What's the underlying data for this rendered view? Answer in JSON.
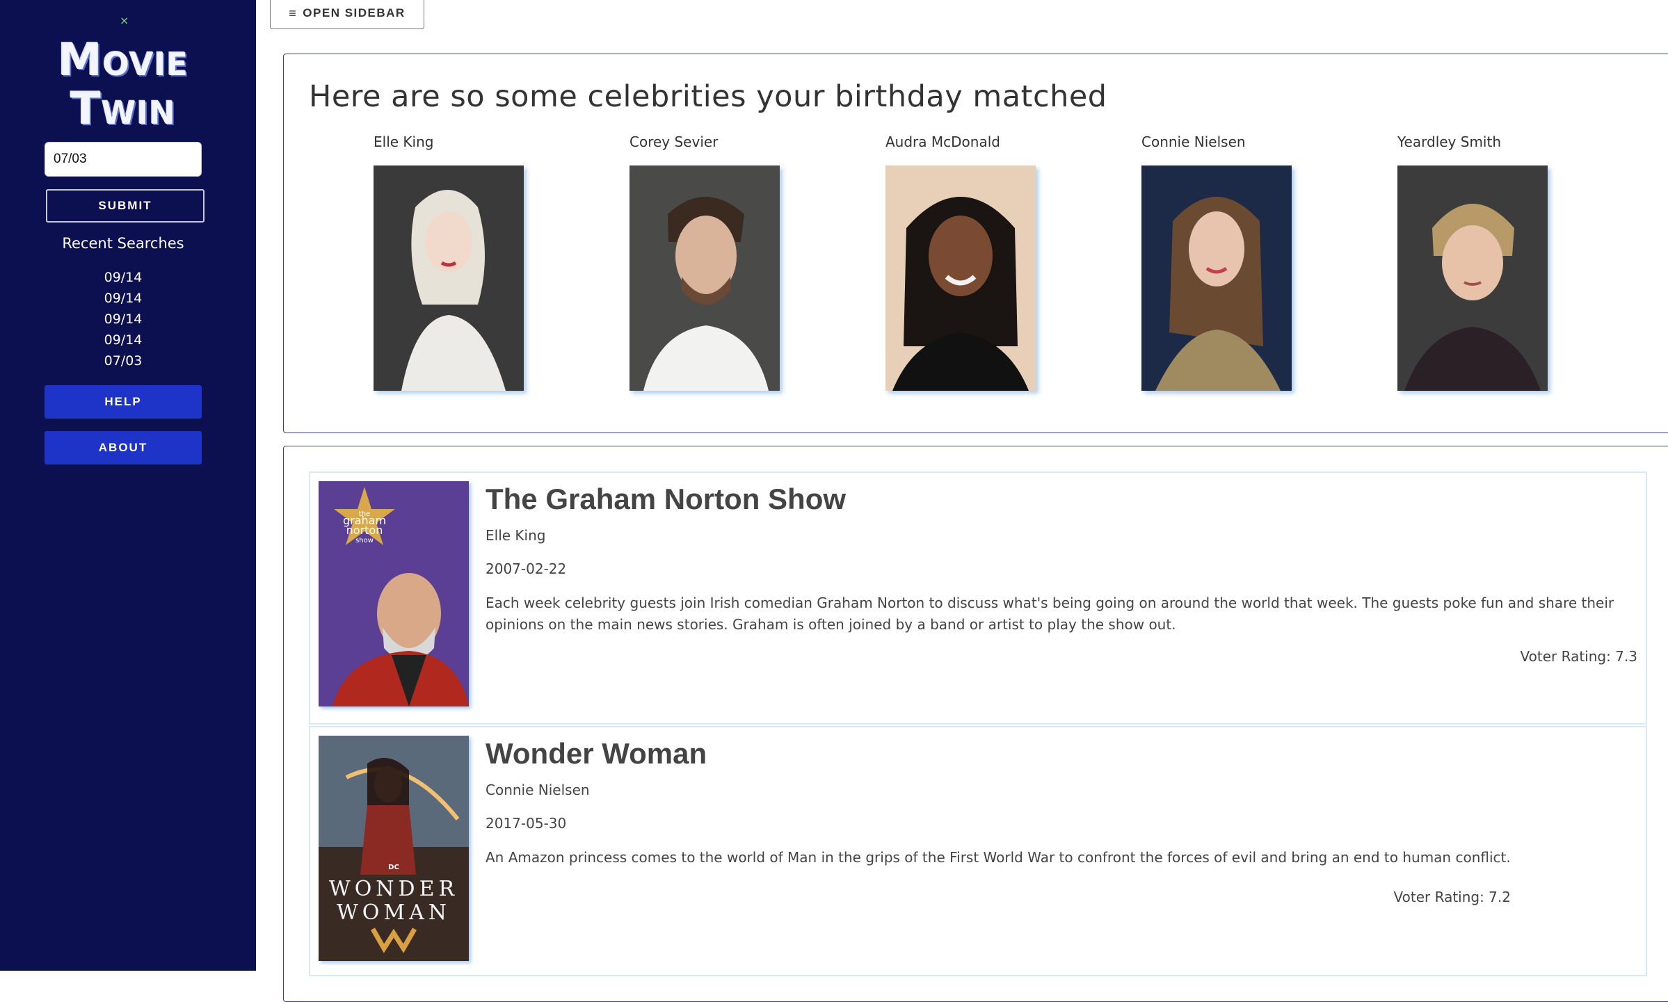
{
  "sidebar": {
    "close_icon": "×",
    "logo_line1": "Movie",
    "logo_line2": "Twin",
    "date_value": "07/03",
    "submit_label": "SUBMIT",
    "recent_title": "Recent Searches",
    "recent": [
      "09/14",
      "09/14",
      "09/14",
      "09/14",
      "07/03"
    ],
    "help_label": "HELP",
    "about_label": "ABOUT"
  },
  "header": {
    "open_sidebar_icon": "≡",
    "open_sidebar_label": "OPEN SIDEBAR"
  },
  "celebrities": {
    "heading": "Here are so some celebrities your birthday matched",
    "items": [
      {
        "name": "Elle King"
      },
      {
        "name": "Corey Sevier"
      },
      {
        "name": "Audra McDonald"
      },
      {
        "name": "Connie Nielsen"
      },
      {
        "name": "Yeardley Smith"
      }
    ]
  },
  "results": [
    {
      "title": "The Graham Norton Show",
      "actor": "Elle King",
      "date": "2007-02-22",
      "overview": "Each week celebrity guests join Irish comedian Graham Norton to discuss what's being going on around the world that week. The guests poke fun and share their opinions on the main news stories. Graham is often joined by a band or artist to play the show out.",
      "rating": "Voter Rating: 7.3",
      "poster_text": [
        "the",
        "graham",
        "norton",
        "show"
      ]
    },
    {
      "title": "Wonder Woman",
      "actor": "Connie Nielsen",
      "date": "2017-05-30",
      "overview": "An Amazon princess comes to the world of Man in the grips of the First World War to confront the forces of evil and bring an end to human conflict.",
      "rating": "Voter Rating: 7.2",
      "poster_text": [
        "DC",
        "WONDER",
        "WOMAN"
      ]
    }
  ]
}
